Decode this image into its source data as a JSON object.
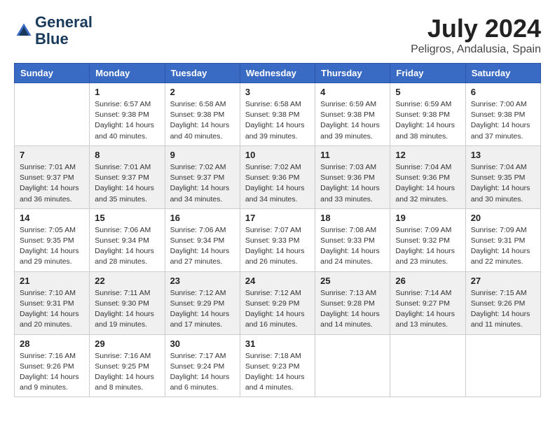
{
  "header": {
    "logo_line1": "General",
    "logo_line2": "Blue",
    "title": "July 2024",
    "subtitle": "Peligros, Andalusia, Spain"
  },
  "days_of_week": [
    "Sunday",
    "Monday",
    "Tuesday",
    "Wednesday",
    "Thursday",
    "Friday",
    "Saturday"
  ],
  "weeks": [
    [
      {
        "day": "",
        "info": ""
      },
      {
        "day": "1",
        "info": "Sunrise: 6:57 AM\nSunset: 9:38 PM\nDaylight: 14 hours\nand 40 minutes."
      },
      {
        "day": "2",
        "info": "Sunrise: 6:58 AM\nSunset: 9:38 PM\nDaylight: 14 hours\nand 40 minutes."
      },
      {
        "day": "3",
        "info": "Sunrise: 6:58 AM\nSunset: 9:38 PM\nDaylight: 14 hours\nand 39 minutes."
      },
      {
        "day": "4",
        "info": "Sunrise: 6:59 AM\nSunset: 9:38 PM\nDaylight: 14 hours\nand 39 minutes."
      },
      {
        "day": "5",
        "info": "Sunrise: 6:59 AM\nSunset: 9:38 PM\nDaylight: 14 hours\nand 38 minutes."
      },
      {
        "day": "6",
        "info": "Sunrise: 7:00 AM\nSunset: 9:38 PM\nDaylight: 14 hours\nand 37 minutes."
      }
    ],
    [
      {
        "day": "7",
        "info": "Sunrise: 7:01 AM\nSunset: 9:37 PM\nDaylight: 14 hours\nand 36 minutes."
      },
      {
        "day": "8",
        "info": "Sunrise: 7:01 AM\nSunset: 9:37 PM\nDaylight: 14 hours\nand 35 minutes."
      },
      {
        "day": "9",
        "info": "Sunrise: 7:02 AM\nSunset: 9:37 PM\nDaylight: 14 hours\nand 34 minutes."
      },
      {
        "day": "10",
        "info": "Sunrise: 7:02 AM\nSunset: 9:36 PM\nDaylight: 14 hours\nand 34 minutes."
      },
      {
        "day": "11",
        "info": "Sunrise: 7:03 AM\nSunset: 9:36 PM\nDaylight: 14 hours\nand 33 minutes."
      },
      {
        "day": "12",
        "info": "Sunrise: 7:04 AM\nSunset: 9:36 PM\nDaylight: 14 hours\nand 32 minutes."
      },
      {
        "day": "13",
        "info": "Sunrise: 7:04 AM\nSunset: 9:35 PM\nDaylight: 14 hours\nand 30 minutes."
      }
    ],
    [
      {
        "day": "14",
        "info": "Sunrise: 7:05 AM\nSunset: 9:35 PM\nDaylight: 14 hours\nand 29 minutes."
      },
      {
        "day": "15",
        "info": "Sunrise: 7:06 AM\nSunset: 9:34 PM\nDaylight: 14 hours\nand 28 minutes."
      },
      {
        "day": "16",
        "info": "Sunrise: 7:06 AM\nSunset: 9:34 PM\nDaylight: 14 hours\nand 27 minutes."
      },
      {
        "day": "17",
        "info": "Sunrise: 7:07 AM\nSunset: 9:33 PM\nDaylight: 14 hours\nand 26 minutes."
      },
      {
        "day": "18",
        "info": "Sunrise: 7:08 AM\nSunset: 9:33 PM\nDaylight: 14 hours\nand 24 minutes."
      },
      {
        "day": "19",
        "info": "Sunrise: 7:09 AM\nSunset: 9:32 PM\nDaylight: 14 hours\nand 23 minutes."
      },
      {
        "day": "20",
        "info": "Sunrise: 7:09 AM\nSunset: 9:31 PM\nDaylight: 14 hours\nand 22 minutes."
      }
    ],
    [
      {
        "day": "21",
        "info": "Sunrise: 7:10 AM\nSunset: 9:31 PM\nDaylight: 14 hours\nand 20 minutes."
      },
      {
        "day": "22",
        "info": "Sunrise: 7:11 AM\nSunset: 9:30 PM\nDaylight: 14 hours\nand 19 minutes."
      },
      {
        "day": "23",
        "info": "Sunrise: 7:12 AM\nSunset: 9:29 PM\nDaylight: 14 hours\nand 17 minutes."
      },
      {
        "day": "24",
        "info": "Sunrise: 7:12 AM\nSunset: 9:29 PM\nDaylight: 14 hours\nand 16 minutes."
      },
      {
        "day": "25",
        "info": "Sunrise: 7:13 AM\nSunset: 9:28 PM\nDaylight: 14 hours\nand 14 minutes."
      },
      {
        "day": "26",
        "info": "Sunrise: 7:14 AM\nSunset: 9:27 PM\nDaylight: 14 hours\nand 13 minutes."
      },
      {
        "day": "27",
        "info": "Sunrise: 7:15 AM\nSunset: 9:26 PM\nDaylight: 14 hours\nand 11 minutes."
      }
    ],
    [
      {
        "day": "28",
        "info": "Sunrise: 7:16 AM\nSunset: 9:26 PM\nDaylight: 14 hours\nand 9 minutes."
      },
      {
        "day": "29",
        "info": "Sunrise: 7:16 AM\nSunset: 9:25 PM\nDaylight: 14 hours\nand 8 minutes."
      },
      {
        "day": "30",
        "info": "Sunrise: 7:17 AM\nSunset: 9:24 PM\nDaylight: 14 hours\nand 6 minutes."
      },
      {
        "day": "31",
        "info": "Sunrise: 7:18 AM\nSunset: 9:23 PM\nDaylight: 14 hours\nand 4 minutes."
      },
      {
        "day": "",
        "info": ""
      },
      {
        "day": "",
        "info": ""
      },
      {
        "day": "",
        "info": ""
      }
    ]
  ]
}
